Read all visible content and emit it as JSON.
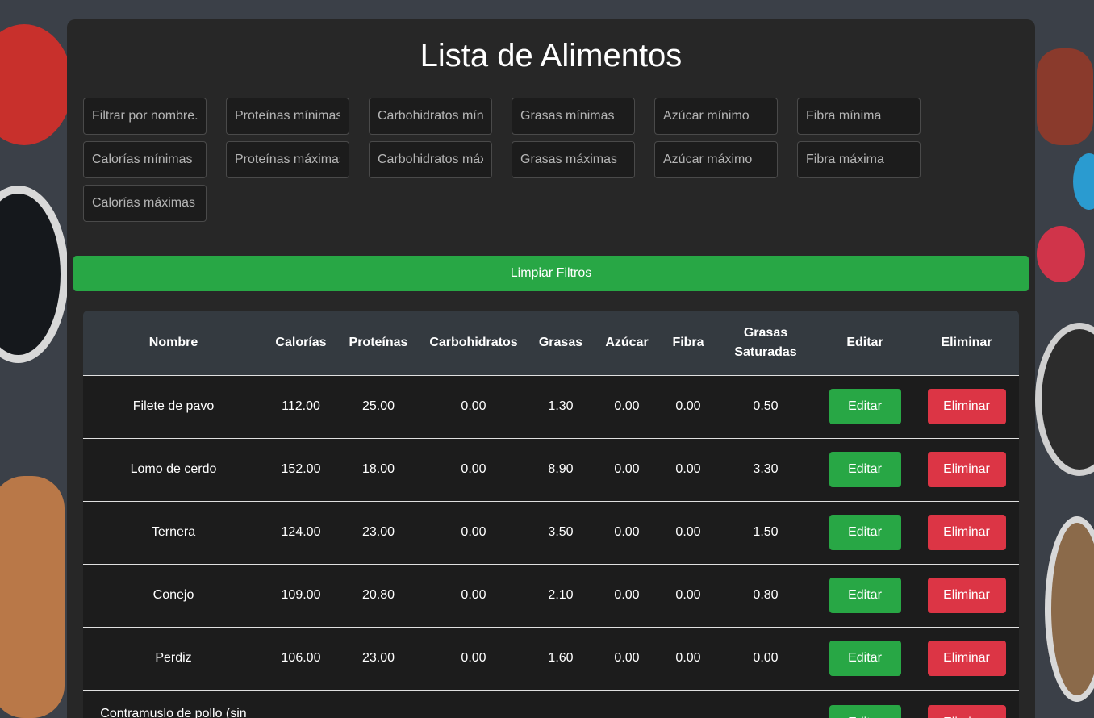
{
  "page": {
    "title": "Lista de Alimentos"
  },
  "filters": {
    "nombre": "Filtrar por nombre...",
    "proteinas_min": "Proteínas mínimas",
    "carbohidratos_min": "Carbohidratos mínimos",
    "grasas_min": "Grasas mínimas",
    "azucar_min": "Azúcar mínimo",
    "fibra_min": "Fibra mínima",
    "calorias_min": "Calorías mínimas",
    "proteinas_max": "Proteínas máximas",
    "carbohidratos_max": "Carbohidratos máximos",
    "grasas_max": "Grasas máximas",
    "azucar_max": "Azúcar máximo",
    "fibra_max": "Fibra máxima",
    "calorias_max": "Calorías máximas"
  },
  "clear_button": "Limpiar Filtros",
  "table": {
    "headers": [
      "Nombre",
      "Calorías",
      "Proteínas",
      "Carbohidratos",
      "Grasas",
      "Azúcar",
      "Fibra",
      "Grasas Saturadas",
      "Editar",
      "Eliminar"
    ],
    "edit_label": "Editar",
    "delete_label": "Eliminar",
    "rows": [
      [
        "Filete de pavo",
        "112.00",
        "25.00",
        "0.00",
        "1.30",
        "0.00",
        "0.00",
        "0.50"
      ],
      [
        "Lomo de cerdo",
        "152.00",
        "18.00",
        "0.00",
        "8.90",
        "0.00",
        "0.00",
        "3.30"
      ],
      [
        "Ternera",
        "124.00",
        "23.00",
        "0.00",
        "3.50",
        "0.00",
        "0.00",
        "1.50"
      ],
      [
        "Conejo",
        "109.00",
        "20.80",
        "0.00",
        "2.10",
        "0.00",
        "0.00",
        "0.80"
      ],
      [
        "Perdiz",
        "106.00",
        "23.00",
        "0.00",
        "1.60",
        "0.00",
        "0.00",
        "0.00"
      ],
      [
        "Contramuslo de pollo (sin",
        "",
        "",
        "",
        "",
        "",
        "",
        ""
      ]
    ]
  },
  "colors": {
    "panel": "#272727",
    "table_header": "#343a40",
    "row": "#1c1c1c",
    "success": "#28a745",
    "danger": "#dc3545"
  }
}
